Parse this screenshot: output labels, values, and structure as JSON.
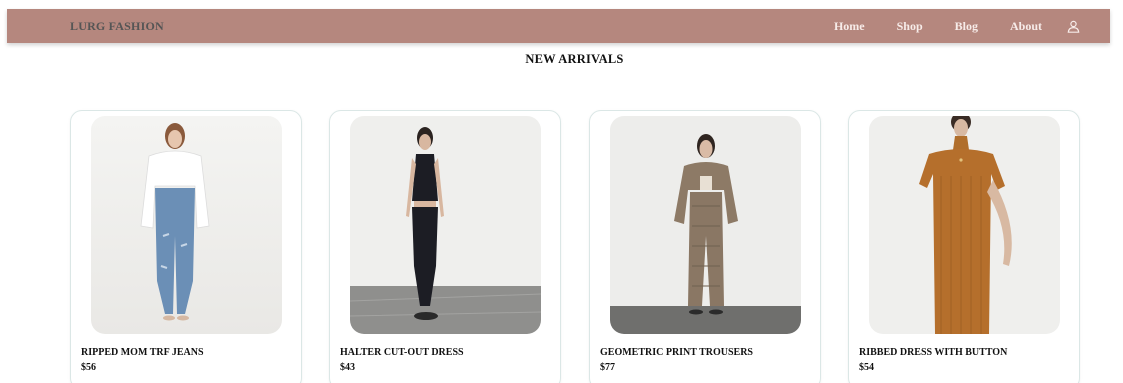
{
  "colors": {
    "navbar_bg": "#b5877e",
    "brand_text": "#555555",
    "nav_link_text": "#f7ece9",
    "card_border": "#dbe7e6"
  },
  "navbar": {
    "brand": "LURG FASHION",
    "links": [
      {
        "label": "Home"
      },
      {
        "label": "Shop"
      },
      {
        "label": "Blog"
      },
      {
        "label": "About"
      }
    ],
    "user_icon": "user-icon"
  },
  "section": {
    "title": "NEW ARRIVALS"
  },
  "products": [
    {
      "name": "RIPPED MOM TRF JEANS",
      "price": "$56"
    },
    {
      "name": "HALTER CUT-OUT DRESS",
      "price": "$43"
    },
    {
      "name": "GEOMETRIC PRINT TROUSERS",
      "price": "$77"
    },
    {
      "name": "RIBBED DRESS WITH BUTTON",
      "price": "$54"
    }
  ]
}
